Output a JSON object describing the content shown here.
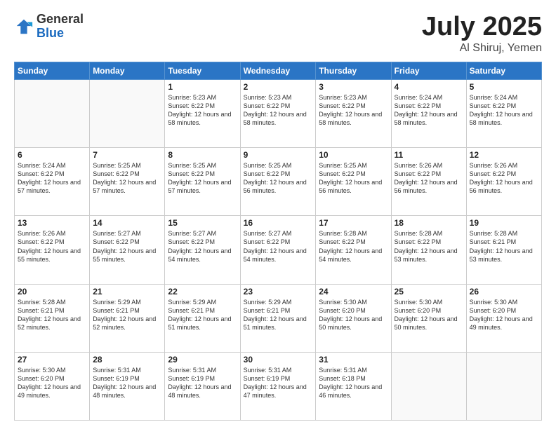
{
  "logo": {
    "general": "General",
    "blue": "Blue"
  },
  "title": {
    "month": "July 2025",
    "location": "Al Shiruj, Yemen"
  },
  "weekdays": [
    "Sunday",
    "Monday",
    "Tuesday",
    "Wednesday",
    "Thursday",
    "Friday",
    "Saturday"
  ],
  "weeks": [
    [
      {
        "day": "",
        "sunrise": "",
        "sunset": "",
        "daylight": ""
      },
      {
        "day": "",
        "sunrise": "",
        "sunset": "",
        "daylight": ""
      },
      {
        "day": "1",
        "sunrise": "Sunrise: 5:23 AM",
        "sunset": "Sunset: 6:22 PM",
        "daylight": "Daylight: 12 hours and 58 minutes."
      },
      {
        "day": "2",
        "sunrise": "Sunrise: 5:23 AM",
        "sunset": "Sunset: 6:22 PM",
        "daylight": "Daylight: 12 hours and 58 minutes."
      },
      {
        "day": "3",
        "sunrise": "Sunrise: 5:23 AM",
        "sunset": "Sunset: 6:22 PM",
        "daylight": "Daylight: 12 hours and 58 minutes."
      },
      {
        "day": "4",
        "sunrise": "Sunrise: 5:24 AM",
        "sunset": "Sunset: 6:22 PM",
        "daylight": "Daylight: 12 hours and 58 minutes."
      },
      {
        "day": "5",
        "sunrise": "Sunrise: 5:24 AM",
        "sunset": "Sunset: 6:22 PM",
        "daylight": "Daylight: 12 hours and 58 minutes."
      }
    ],
    [
      {
        "day": "6",
        "sunrise": "Sunrise: 5:24 AM",
        "sunset": "Sunset: 6:22 PM",
        "daylight": "Daylight: 12 hours and 57 minutes."
      },
      {
        "day": "7",
        "sunrise": "Sunrise: 5:25 AM",
        "sunset": "Sunset: 6:22 PM",
        "daylight": "Daylight: 12 hours and 57 minutes."
      },
      {
        "day": "8",
        "sunrise": "Sunrise: 5:25 AM",
        "sunset": "Sunset: 6:22 PM",
        "daylight": "Daylight: 12 hours and 57 minutes."
      },
      {
        "day": "9",
        "sunrise": "Sunrise: 5:25 AM",
        "sunset": "Sunset: 6:22 PM",
        "daylight": "Daylight: 12 hours and 56 minutes."
      },
      {
        "day": "10",
        "sunrise": "Sunrise: 5:25 AM",
        "sunset": "Sunset: 6:22 PM",
        "daylight": "Daylight: 12 hours and 56 minutes."
      },
      {
        "day": "11",
        "sunrise": "Sunrise: 5:26 AM",
        "sunset": "Sunset: 6:22 PM",
        "daylight": "Daylight: 12 hours and 56 minutes."
      },
      {
        "day": "12",
        "sunrise": "Sunrise: 5:26 AM",
        "sunset": "Sunset: 6:22 PM",
        "daylight": "Daylight: 12 hours and 56 minutes."
      }
    ],
    [
      {
        "day": "13",
        "sunrise": "Sunrise: 5:26 AM",
        "sunset": "Sunset: 6:22 PM",
        "daylight": "Daylight: 12 hours and 55 minutes."
      },
      {
        "day": "14",
        "sunrise": "Sunrise: 5:27 AM",
        "sunset": "Sunset: 6:22 PM",
        "daylight": "Daylight: 12 hours and 55 minutes."
      },
      {
        "day": "15",
        "sunrise": "Sunrise: 5:27 AM",
        "sunset": "Sunset: 6:22 PM",
        "daylight": "Daylight: 12 hours and 54 minutes."
      },
      {
        "day": "16",
        "sunrise": "Sunrise: 5:27 AM",
        "sunset": "Sunset: 6:22 PM",
        "daylight": "Daylight: 12 hours and 54 minutes."
      },
      {
        "day": "17",
        "sunrise": "Sunrise: 5:28 AM",
        "sunset": "Sunset: 6:22 PM",
        "daylight": "Daylight: 12 hours and 54 minutes."
      },
      {
        "day": "18",
        "sunrise": "Sunrise: 5:28 AM",
        "sunset": "Sunset: 6:22 PM",
        "daylight": "Daylight: 12 hours and 53 minutes."
      },
      {
        "day": "19",
        "sunrise": "Sunrise: 5:28 AM",
        "sunset": "Sunset: 6:21 PM",
        "daylight": "Daylight: 12 hours and 53 minutes."
      }
    ],
    [
      {
        "day": "20",
        "sunrise": "Sunrise: 5:28 AM",
        "sunset": "Sunset: 6:21 PM",
        "daylight": "Daylight: 12 hours and 52 minutes."
      },
      {
        "day": "21",
        "sunrise": "Sunrise: 5:29 AM",
        "sunset": "Sunset: 6:21 PM",
        "daylight": "Daylight: 12 hours and 52 minutes."
      },
      {
        "day": "22",
        "sunrise": "Sunrise: 5:29 AM",
        "sunset": "Sunset: 6:21 PM",
        "daylight": "Daylight: 12 hours and 51 minutes."
      },
      {
        "day": "23",
        "sunrise": "Sunrise: 5:29 AM",
        "sunset": "Sunset: 6:21 PM",
        "daylight": "Daylight: 12 hours and 51 minutes."
      },
      {
        "day": "24",
        "sunrise": "Sunrise: 5:30 AM",
        "sunset": "Sunset: 6:20 PM",
        "daylight": "Daylight: 12 hours and 50 minutes."
      },
      {
        "day": "25",
        "sunrise": "Sunrise: 5:30 AM",
        "sunset": "Sunset: 6:20 PM",
        "daylight": "Daylight: 12 hours and 50 minutes."
      },
      {
        "day": "26",
        "sunrise": "Sunrise: 5:30 AM",
        "sunset": "Sunset: 6:20 PM",
        "daylight": "Daylight: 12 hours and 49 minutes."
      }
    ],
    [
      {
        "day": "27",
        "sunrise": "Sunrise: 5:30 AM",
        "sunset": "Sunset: 6:20 PM",
        "daylight": "Daylight: 12 hours and 49 minutes."
      },
      {
        "day": "28",
        "sunrise": "Sunrise: 5:31 AM",
        "sunset": "Sunset: 6:19 PM",
        "daylight": "Daylight: 12 hours and 48 minutes."
      },
      {
        "day": "29",
        "sunrise": "Sunrise: 5:31 AM",
        "sunset": "Sunset: 6:19 PM",
        "daylight": "Daylight: 12 hours and 48 minutes."
      },
      {
        "day": "30",
        "sunrise": "Sunrise: 5:31 AM",
        "sunset": "Sunset: 6:19 PM",
        "daylight": "Daylight: 12 hours and 47 minutes."
      },
      {
        "day": "31",
        "sunrise": "Sunrise: 5:31 AM",
        "sunset": "Sunset: 6:18 PM",
        "daylight": "Daylight: 12 hours and 46 minutes."
      },
      {
        "day": "",
        "sunrise": "",
        "sunset": "",
        "daylight": ""
      },
      {
        "day": "",
        "sunrise": "",
        "sunset": "",
        "daylight": ""
      }
    ]
  ]
}
